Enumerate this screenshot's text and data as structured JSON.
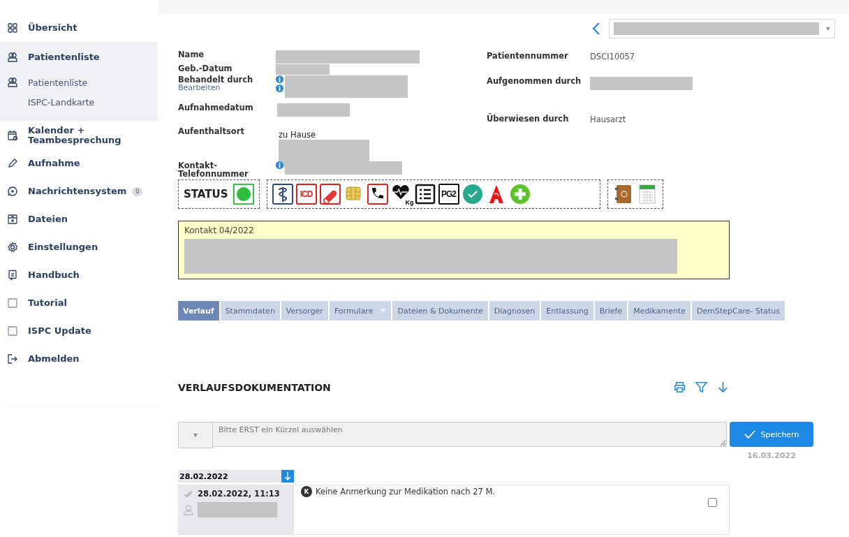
{
  "sidebar": {
    "items": [
      {
        "label": "Übersicht",
        "selected": false
      },
      {
        "label": "Patientenliste",
        "selected": true,
        "children": [
          {
            "label": "Patientenliste"
          },
          {
            "label": "ISPC-Landkarte"
          }
        ]
      },
      {
        "label": "Kalender + Teambesprechung",
        "selected": false
      },
      {
        "label": "Aufnahme",
        "selected": false
      },
      {
        "label": "Nachrichtensystem",
        "selected": false,
        "badge": "0"
      },
      {
        "label": "Dateien",
        "selected": false
      },
      {
        "label": "Einstellungen",
        "selected": false
      },
      {
        "label": "Handbuch",
        "selected": false
      },
      {
        "label": "Tutorial",
        "selected": false
      },
      {
        "label": "ISPC Update",
        "selected": false
      },
      {
        "label": "Abmelden",
        "selected": false
      }
    ]
  },
  "patient": {
    "left": [
      {
        "label": "Name"
      },
      {
        "label": "Geb.-Datum"
      },
      {
        "label": "Behandelt durch",
        "link": "Bearbeiten"
      },
      {
        "label": "Aufnahmedatum"
      },
      {
        "label": "Aufenthaltsort",
        "value": "zu Hause"
      },
      {
        "label": "Kontakt-Telefonnummer"
      }
    ],
    "right": [
      {
        "label": "Patientennummer",
        "value": "DSCI10057"
      },
      {
        "label": "Aufgenommen durch"
      },
      {
        "label": "Überwiesen durch",
        "value": "Hausarzt"
      }
    ]
  },
  "toolbar": {
    "status_label": "STATUS",
    "icon_texts": [
      "ICD",
      "Kg",
      "PG2"
    ]
  },
  "note": {
    "title": "Kontakt 04/2022"
  },
  "tabs": [
    {
      "label": "Verlauf",
      "selected": true,
      "menu": false
    },
    {
      "label": "Stammdaten",
      "selected": false,
      "menu": false
    },
    {
      "label": "Versorger",
      "selected": false,
      "menu": false
    },
    {
      "label": "Formulare",
      "selected": false,
      "menu": true
    },
    {
      "label": "Dateien & Dokumente",
      "selected": false,
      "menu": false
    },
    {
      "label": "Diagnosen",
      "selected": false,
      "menu": false
    },
    {
      "label": "Entlassung",
      "selected": false,
      "menu": false
    },
    {
      "label": "Briefe",
      "selected": false,
      "menu": false
    },
    {
      "label": "Medikamente",
      "selected": false,
      "menu": false
    },
    {
      "label": "DemStepCare- Status",
      "selected": false,
      "menu": false
    }
  ],
  "documentation": {
    "title": "VERLAUFSDOKUMENTATION",
    "placeholder": "Bitte ERST ein Kürzel auswählen",
    "save_button": "Speichern",
    "date": "16.03.2022",
    "day": "28.02.2022",
    "entries": [
      {
        "timestamp": "28.02.2022, 11:13",
        "badge": "K",
        "text": "Keine Anmerkung zur Medikation nach 27 M.",
        "checked": false
      }
    ]
  }
}
